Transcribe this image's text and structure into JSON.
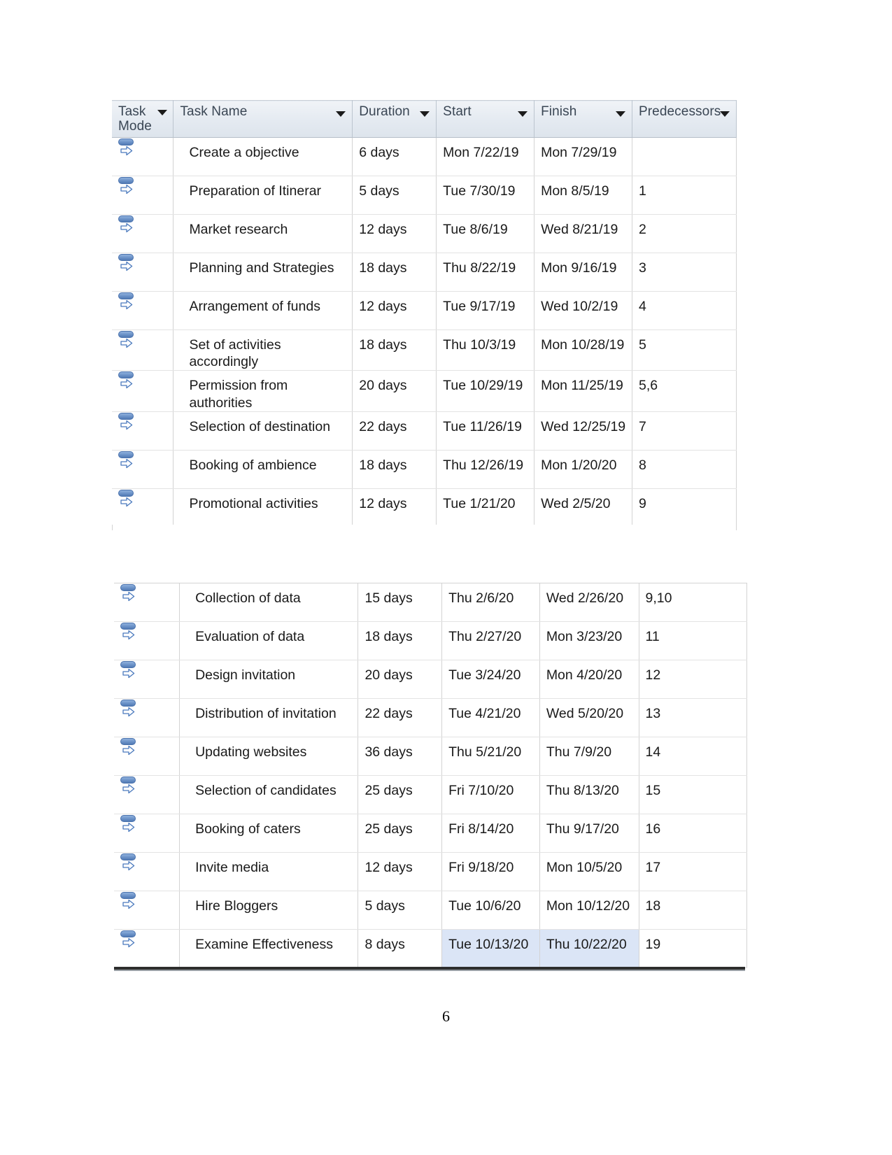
{
  "document": {
    "page_number": "6"
  },
  "columns": [
    {
      "key": "task_mode",
      "label": "Task\nMode",
      "icon": "filter-dropdown-icon"
    },
    {
      "key": "task_name",
      "label": "Task Name",
      "icon": "filter-dropdown-icon"
    },
    {
      "key": "duration",
      "label": "Duration",
      "icon": "filter-dropdown-icon"
    },
    {
      "key": "start",
      "label": "Start",
      "icon": "filter-dropdown-icon"
    },
    {
      "key": "finish",
      "label": "Finish",
      "icon": "filter-dropdown-icon"
    },
    {
      "key": "predecessors",
      "label": "Predecessors",
      "icon": "filter-dropdown-icon"
    }
  ],
  "table_1": {
    "rows": [
      {
        "task_mode_icon": "manually-scheduled-icon",
        "task_name": "Create a objective",
        "duration": "6 days",
        "start": "Mon 7/22/19",
        "finish": "Mon 7/29/19",
        "predecessors": ""
      },
      {
        "task_mode_icon": "manually-scheduled-icon",
        "task_name": "Preparation of Itinerar",
        "duration": "5 days",
        "start": "Tue 7/30/19",
        "finish": "Mon 8/5/19",
        "predecessors": "1"
      },
      {
        "task_mode_icon": "manually-scheduled-icon",
        "task_name": "Market research",
        "duration": "12 days",
        "start": "Tue 8/6/19",
        "finish": "Wed 8/21/19",
        "predecessors": "2"
      },
      {
        "task_mode_icon": "manually-scheduled-icon",
        "task_name": "Planning and Strategies",
        "duration": "18 days",
        "start": "Thu 8/22/19",
        "finish": "Mon 9/16/19",
        "predecessors": "3"
      },
      {
        "task_mode_icon": "manually-scheduled-icon",
        "task_name": "Arrangement of funds",
        "duration": "12 days",
        "start": "Tue 9/17/19",
        "finish": "Wed 10/2/19",
        "predecessors": "4"
      },
      {
        "task_mode_icon": "manually-scheduled-icon",
        "task_name": "Set of activities accordingly",
        "duration": "18 days",
        "start": "Thu 10/3/19",
        "finish": "Mon 10/28/19",
        "predecessors": "5"
      },
      {
        "task_mode_icon": "manually-scheduled-icon",
        "task_name": "Permission from authorities",
        "duration": "20 days",
        "start": "Tue 10/29/19",
        "finish": "Mon 11/25/19",
        "predecessors": "5,6"
      },
      {
        "task_mode_icon": "manually-scheduled-icon",
        "task_name": "Selection of destination",
        "duration": "22 days",
        "start": "Tue 11/26/19",
        "finish": "Wed 12/25/19",
        "predecessors": "7"
      },
      {
        "task_mode_icon": "manually-scheduled-icon",
        "task_name": "Booking of ambience",
        "duration": "18 days",
        "start": "Thu 12/26/19",
        "finish": "Mon 1/20/20",
        "predecessors": "8"
      },
      {
        "task_mode_icon": "manually-scheduled-icon",
        "task_name": "Promotional activities",
        "duration": "12 days",
        "start": "Tue 1/21/20",
        "finish": "Wed 2/5/20",
        "predecessors": "9"
      }
    ]
  },
  "table_2": {
    "rows": [
      {
        "task_mode_icon": "manually-scheduled-icon",
        "task_name": "Collection of data",
        "duration": "15 days",
        "start": "Thu 2/6/20",
        "finish": "Wed 2/26/20",
        "predecessors": "9,10"
      },
      {
        "task_mode_icon": "manually-scheduled-icon",
        "task_name": "Evaluation of data",
        "duration": "18 days",
        "start": "Thu 2/27/20",
        "finish": "Mon 3/23/20",
        "predecessors": "11"
      },
      {
        "task_mode_icon": "manually-scheduled-icon",
        "task_name": "Design invitation",
        "duration": "20 days",
        "start": "Tue 3/24/20",
        "finish": "Mon 4/20/20",
        "predecessors": "12"
      },
      {
        "task_mode_icon": "manually-scheduled-icon",
        "task_name": "Distribution of invitation",
        "duration": "22 days",
        "start": "Tue 4/21/20",
        "finish": "Wed 5/20/20",
        "predecessors": "13"
      },
      {
        "task_mode_icon": "manually-scheduled-icon",
        "task_name": "Updating websites",
        "duration": "36 days",
        "start": "Thu 5/21/20",
        "finish": "Thu 7/9/20",
        "predecessors": "14"
      },
      {
        "task_mode_icon": "manually-scheduled-icon",
        "task_name": "Selection of candidates",
        "duration": "25 days",
        "start": "Fri 7/10/20",
        "finish": "Thu 8/13/20",
        "predecessors": "15"
      },
      {
        "task_mode_icon": "manually-scheduled-icon",
        "task_name": "Booking of caters",
        "duration": "25 days",
        "start": "Fri 8/14/20",
        "finish": "Thu 9/17/20",
        "predecessors": "16"
      },
      {
        "task_mode_icon": "manually-scheduled-icon",
        "task_name": "Invite media",
        "duration": "12 days",
        "start": "Fri 9/18/20",
        "finish": "Mon 10/5/20",
        "predecessors": "17"
      },
      {
        "task_mode_icon": "manually-scheduled-icon",
        "task_name": "Hire Bloggers",
        "duration": "5 days",
        "start": "Tue 10/6/20",
        "finish": "Mon 10/12/20",
        "predecessors": "18"
      },
      {
        "task_mode_icon": "manually-scheduled-icon",
        "task_name": "Examine Effectiveness",
        "duration": "8 days",
        "start": "Tue 10/13/20",
        "finish": "Thu 10/22/20",
        "predecessors": "19",
        "selected": true
      }
    ]
  },
  "colors": {
    "header_gradient_top": "#f0f3f7",
    "header_gradient_bottom": "#dde4ec",
    "grid_line": "#d3d3d3",
    "icon_blue": "#517ab5",
    "selection_highlight": "#dbe5f6",
    "text": "#1a1a1a"
  }
}
